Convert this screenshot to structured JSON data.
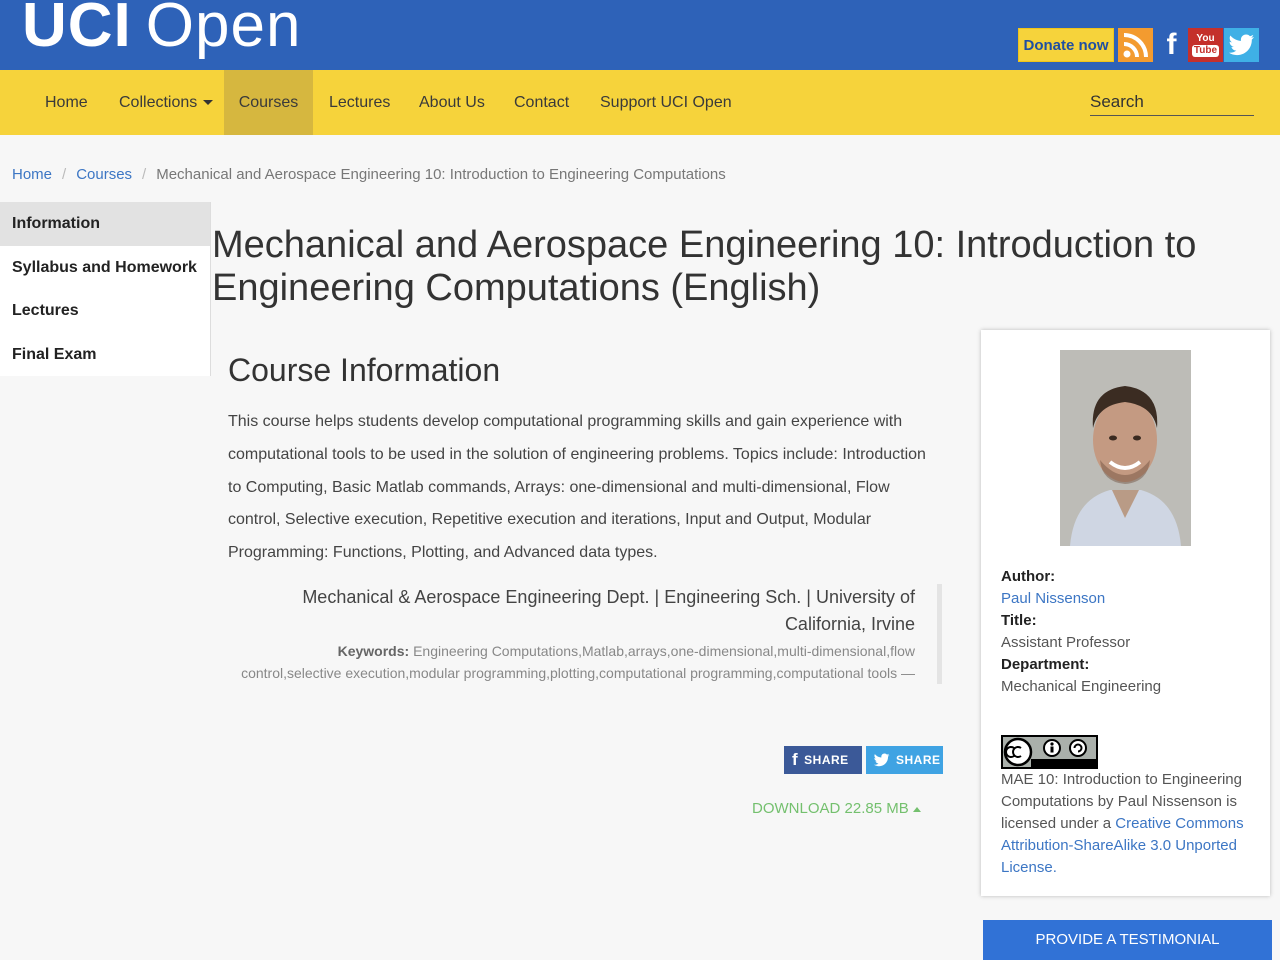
{
  "header": {
    "logo_uci": "UCI",
    "logo_open": "Open",
    "donate_label": "Donate now",
    "youtube_top": "You",
    "youtube_bottom": "Tube"
  },
  "nav": {
    "items": [
      {
        "label": "Home"
      },
      {
        "label": "Collections"
      },
      {
        "label": "Courses"
      },
      {
        "label": "Lectures"
      },
      {
        "label": "About Us"
      },
      {
        "label": "Contact"
      },
      {
        "label": "Support UCI Open"
      }
    ],
    "search_placeholder": "Search"
  },
  "breadcrumb": {
    "home": "Home",
    "courses": "Courses",
    "current": "Mechanical and Aerospace Engineering 10: Introduction to Engineering Computations"
  },
  "sidebar": {
    "items": [
      {
        "label": "Information"
      },
      {
        "label": "Syllabus and Homework"
      },
      {
        "label": "Lectures"
      },
      {
        "label": "Final Exam"
      }
    ]
  },
  "main": {
    "title": "Mechanical and Aerospace Engineering 10: Introduction to Engineering Computations (English)",
    "section_title": "Course Information",
    "description": "This course helps students develop computational programming skills and gain experience with computational tools to be used in the solution of engineering problems. Topics include: Introduction to Computing, Basic Matlab commands, Arrays: one-dimensional and multi-dimensional, Flow control, Selective execution, Repetitive execution and iterations, Input and Output, Modular Programming: Functions, Plotting, and Advanced data types.",
    "department_line": "Mechanical & Aerospace Engineering Dept. | Engineering Sch. | University of California, Irvine",
    "keywords_label": "Keywords:",
    "keywords": "Engineering Computations,Matlab,arrays,one-dimensional,multi-dimensional,flow control,selective execution,modular programming,plotting,computational programming,computational tools —",
    "share_facebook": "SHARE",
    "share_twitter": "SHARE",
    "download": "DOWNLOAD 22.85 MB"
  },
  "card": {
    "author_label": "Author:",
    "author": "Paul Nissenson",
    "title_label": "Title:",
    "title": "Assistant Professor",
    "department_label": "Department:",
    "department": "Mechanical Engineering",
    "license_text": "MAE 10: Introduction to Engineering Computations by Paul Nissenson is licensed under a ",
    "license_link": "Creative Commons Attribution-ShareAlike 3.0 Unported License",
    "license_end": "."
  },
  "testimonial_label": "PROVIDE A TESTIMONIAL",
  "colors": {
    "header_blue": "#2e62b8",
    "nav_yellow": "#f6d33b",
    "link_blue": "#3c76c4",
    "download_green": "#74c06e",
    "button_blue": "#3172d6"
  }
}
